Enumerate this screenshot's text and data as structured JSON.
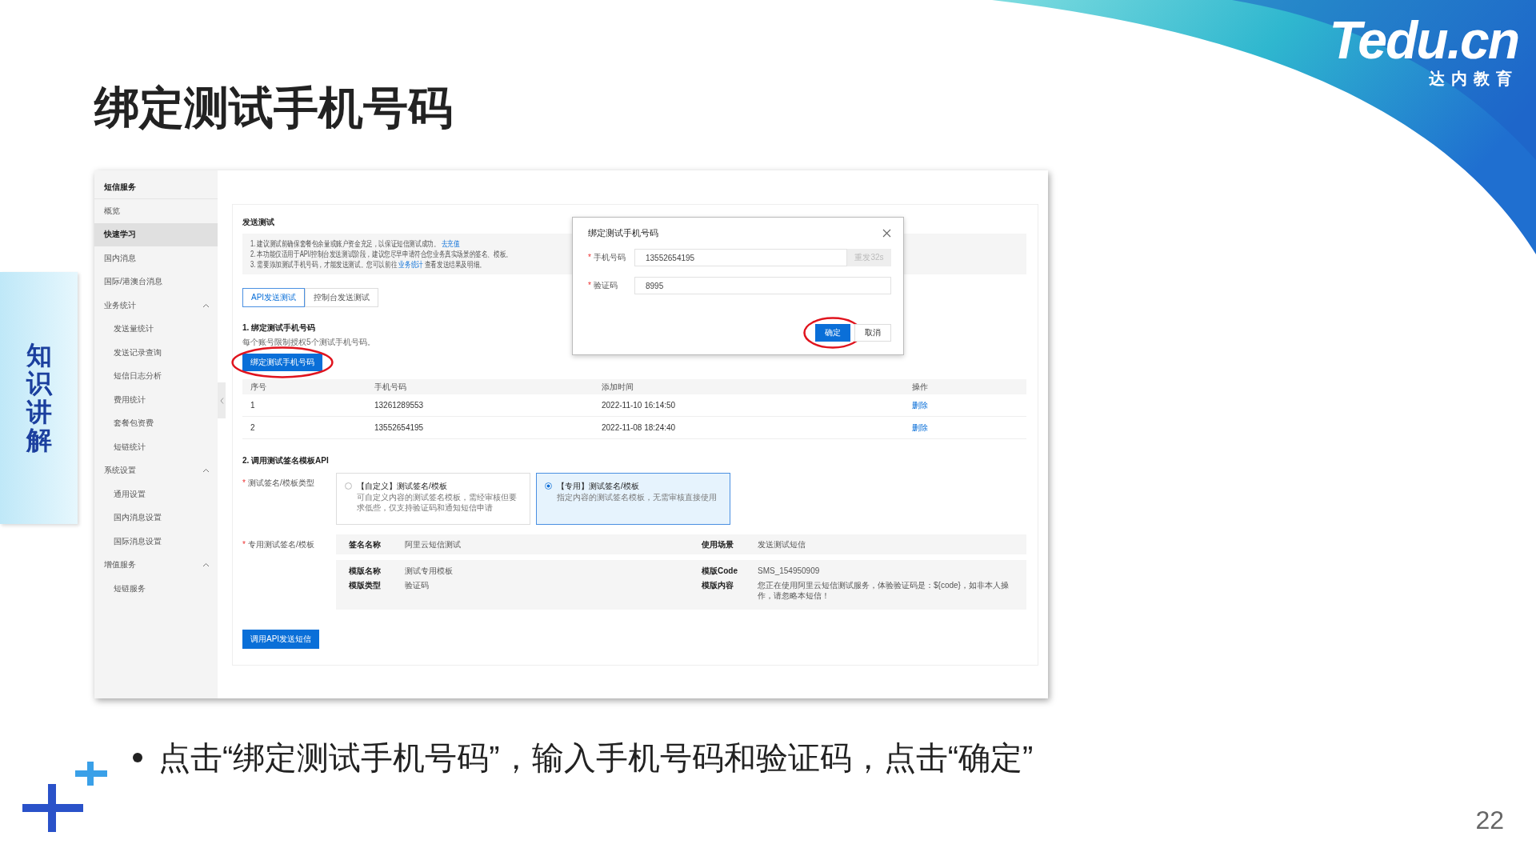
{
  "slide": {
    "title": "绑定测试手机号码",
    "side_tab": "知识讲解",
    "logo": {
      "name": "Tedu.cn",
      "subtitle": "达内教育"
    },
    "bullets": [
      "点击“绑定测试手机号码”，输入手机号码和验证码，点击“确定”"
    ],
    "page_number": "22"
  },
  "console": {
    "sidebar": {
      "title": "短信服务",
      "items": [
        {
          "label": "概览",
          "selected": false
        },
        {
          "label": "快速学习",
          "selected": true
        },
        {
          "label": "国内消息",
          "selected": false
        },
        {
          "label": "国际/港澳台消息",
          "selected": false
        },
        {
          "label": "业务统计",
          "selected": false,
          "expanded": true,
          "children": [
            {
              "label": "发送量统计",
              "selected": false
            },
            {
              "label": "发送记录查询",
              "selected": false
            },
            {
              "label": "短信日志分析",
              "selected": false
            },
            {
              "label": "费用统计",
              "selected": false
            },
            {
              "label": "套餐包资费",
              "selected": false
            },
            {
              "label": "短链统计",
              "selected": false
            }
          ]
        },
        {
          "label": "系统设置",
          "selected": false,
          "expanded": true,
          "children": [
            {
              "label": "通用设置",
              "selected": false
            },
            {
              "label": "国内消息设置",
              "selected": false
            },
            {
              "label": "国际消息设置",
              "selected": false
            }
          ]
        },
        {
          "label": "增值服务",
          "selected": false,
          "expanded": true,
          "children": [
            {
              "label": "短链服务",
              "selected": false
            }
          ]
        }
      ]
    },
    "section_title": "发送测试",
    "notice": [
      {
        "before": "1. 建议测试前确保套餐包余量或账户资金充足，以保证短信测试成功。",
        "link": "去充值"
      },
      {
        "before": "2. 本功能仅适用于API/控制台发送测试阶段，建议您尽早申请符合您业务真实场景的签名、模板。"
      },
      {
        "before": "3. 需要添加测试手机号码，才能发送测试。您可以前往",
        "link": "业务统计",
        "after": "查看发送结果及明细。"
      }
    ],
    "tabs": [
      {
        "label": "API发送测试",
        "selected": true
      },
      {
        "label": "控制台发送测试",
        "selected": false
      }
    ],
    "bind": {
      "heading": "1. 绑定测试手机号码",
      "hint": "每个账号限制授权5个测试手机号码。",
      "button": "绑定测试手机号码",
      "highlighted": true
    },
    "table": {
      "columns": [
        "序号",
        "手机号码",
        "添加时间",
        "操作"
      ],
      "rows": [
        {
          "index": "1",
          "phone": "13261289553",
          "time": "2022-11-10 16:14:50",
          "action": "删除"
        },
        {
          "index": "2",
          "phone": "13552654195",
          "time": "2022-11-08 18:24:40",
          "action": "删除"
        }
      ]
    },
    "api": {
      "heading": "2. 调用测试签名模板API",
      "type_field": {
        "mark": "*",
        "label": "测试签名/模板类型"
      },
      "options": [
        {
          "title": "【自定义】测试签名/模板",
          "desc": "可自定义内容的测试签名模板，需经审核但要求低些，仅支持验证码和通知短信申请",
          "selected": false
        },
        {
          "title": "【专用】测试签名/模板",
          "desc": "指定内容的测试签名模板，无需审核直接使用",
          "selected": true
        }
      ],
      "detail_field": {
        "mark": "*",
        "label": "专用测试签名/模板"
      },
      "details": [
        {
          "rows": [
            [
              {
                "label": "签名名称",
                "value": "阿里云短信测试"
              },
              {
                "label": "使用场景",
                "value": "发送测试短信"
              }
            ]
          ]
        },
        {
          "rows": [
            [
              {
                "label": "模版名称",
                "value": "测试专用模板"
              },
              {
                "label": "模版Code",
                "value": "SMS_154950909"
              }
            ],
            [
              {
                "label": "模版类型",
                "value": "验证码"
              },
              {
                "label": "模版内容",
                "value": "您正在使用阿里云短信测试服务，体验验证码是：${code}，如非本人操作，请忽略本短信！"
              }
            ]
          ]
        }
      ],
      "button": "调用API发送短信"
    },
    "dialog": {
      "title": "绑定测试手机号码",
      "fields": [
        {
          "mark": "*",
          "label": "手机号码",
          "value": "13552654195",
          "addon": "重发32s",
          "addon_disabled": true
        },
        {
          "mark": "*",
          "label": "验证码",
          "value": "8995"
        }
      ],
      "buttons": [
        {
          "label": "确定",
          "kind": "primary",
          "highlighted": true
        },
        {
          "label": "取消",
          "kind": "default",
          "highlighted": false
        }
      ]
    }
  }
}
